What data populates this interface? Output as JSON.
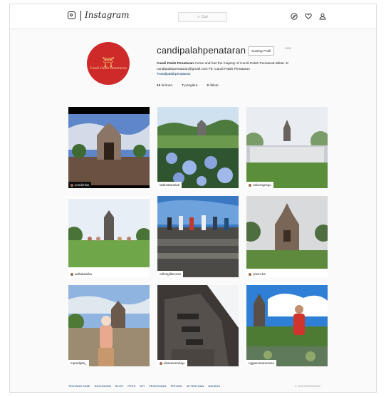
{
  "header": {
    "brand": "Instagram",
    "search_placeholder": "Cari",
    "icons": [
      "instagram-glyph-icon",
      "search-icon",
      "compass-icon",
      "heart-icon",
      "user-icon"
    ]
  },
  "profile": {
    "avatar_text": "Candi Palah Penataran",
    "username": "candipalahpenataran",
    "follow_button": "Sunting Profil",
    "more": "•••",
    "bio_fullname": "Candi Palah Penataran",
    "bio_text": "Come and feel the majesty of Candi Palah Penataran Blitar. E: candipalahpenataran@gmail.com Fb: Candi Palah Penataran",
    "bio_tag": "#candipalahpenataran",
    "stats": [
      {
        "count": "12",
        "label": "kiriman"
      },
      {
        "count": "7",
        "label": "pengikut"
      },
      {
        "count": "2",
        "label": "diikuti"
      }
    ]
  },
  "posts": [
    {
      "caption": "sonderkat",
      "dark": true
    },
    {
      "caption": "ladesatarasati",
      "dark": false
    },
    {
      "caption": "naloungesgo",
      "dark": false
    },
    {
      "caption": "auftabawika",
      "dark": false
    },
    {
      "caption": "odhntgilkesnan",
      "dark": false
    },
    {
      "caption": "yasmi.be",
      "dark": false
    },
    {
      "caption": "mpradipta_",
      "dark": false
    },
    {
      "caption": "abaseirambajo",
      "dark": false
    },
    {
      "caption": "nggaesmaraciana",
      "dark": false
    }
  ],
  "footer": {
    "links": [
      "TENTANG KAMI",
      "DUKUNGAN",
      "BLOG",
      "PERS",
      "API",
      "PEKERJAAN",
      "PRIVASI",
      "KETENTUAN",
      "BAHASA"
    ],
    "copyright": "© 2016 INSTAGRAM"
  },
  "colors": {
    "avatar_bg": "#cf2a2a",
    "link": "#003569",
    "background": "#fafafa"
  }
}
